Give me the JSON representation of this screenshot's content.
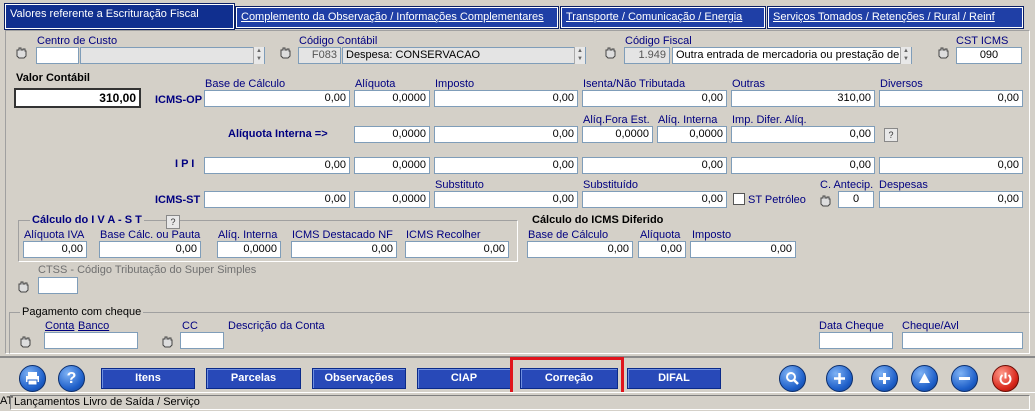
{
  "tabs": [
    "Valores referente a Escrituração Fiscal",
    "Complemento da Observação / Informações Complementares",
    "Transporte / Comunicação / Energia",
    "Serviços Tomados / Retenções / Rural / Reinf"
  ],
  "header": {
    "centro_custo_label": "Centro de Custo",
    "centro_custo_code": "",
    "centro_custo_desc": "",
    "codigo_contabil_label": "Código Contábil",
    "codigo_contabil_code": "F083",
    "codigo_contabil_desc": "Despesa: CONSERVACAO",
    "codigo_fiscal_label": "Código Fiscal",
    "codigo_fiscal_code": "1.949",
    "codigo_fiscal_desc": "Outra entrada de mercadoria ou prestação de",
    "cst_icms_label": "CST ICMS",
    "cst_icms_value": "090"
  },
  "valor_contabil": {
    "label": "Valor Contábil",
    "value": "310,00"
  },
  "icms_op": {
    "row_label": "ICMS-OP",
    "base_label": "Base de Cálculo",
    "base": "0,00",
    "aliquota_label": "Alíquota",
    "aliquota": "0,0000",
    "imposto_label": "Imposto",
    "imposto": "0,00",
    "isenta_label": "Isenta/Não Tributada",
    "isenta": "0,00",
    "outras_label": "Outras",
    "outras": "310,00",
    "diversos_label": "Diversos",
    "diversos": "0,00"
  },
  "aliquota_interna": {
    "row_label": "Alíquota Interna =>",
    "aliquota": "0,0000",
    "imposto": "0,00",
    "aliq_fora_label": "Alíq.Fora Est.",
    "aliq_fora": "0,0000",
    "aliq_interna_label": "Alíq. Interna",
    "aliq_interna": "0,0000",
    "imp_difer_label": "Imp. Difer. Alíq.",
    "imp_difer": "0,00",
    "help": "?"
  },
  "ipi": {
    "row_label": "I P I",
    "base": "0,00",
    "aliquota": "0,0000",
    "imposto": "0,00",
    "isenta": "0,00",
    "outras": "0,00",
    "diversos": "0,00"
  },
  "icms_st": {
    "row_label": "ICMS-ST",
    "base": "0,00",
    "aliquota": "0,0000",
    "imposto": "0,00",
    "substituto_label": "Substituto",
    "substituto": "0,00",
    "substituido_label": "Substituído",
    "substituido": "0,00",
    "st_petroleo_label": "ST Petróleo",
    "c_antecip_label": "C. Antecip.",
    "c_antecip": "0",
    "despesas_label": "Despesas",
    "despesas": "0,00"
  },
  "iva_st": {
    "title": "Cálculo do I V A - S T",
    "help": "?",
    "aliquota_iva_label": "Alíquota IVA",
    "aliquota_iva": "0,00",
    "base_pauta_label": "Base Cálc. ou Pauta",
    "base_pauta": "0,00",
    "aliq_interna_label": "Alíq. Interna",
    "aliq_interna": "0,0000",
    "icms_destacado_label": "ICMS Destacado NF",
    "icms_destacado": "0,00",
    "icms_recolher_label": "ICMS Recolher",
    "icms_recolher": "0,00"
  },
  "diferido": {
    "title": "Cálculo do ICMS Diferido",
    "base_label": "Base de Cálculo",
    "base": "0,00",
    "aliquota_label": "Alíquota",
    "aliquota": "0,00",
    "imposto_label": "Imposto",
    "imposto": "0,00"
  },
  "ctss": {
    "label": "CTSS - Código Tributação do Super Simples",
    "value": ""
  },
  "cheque": {
    "title": "Pagamento com cheque",
    "conta_label": "Conta",
    "banco_label": "Banco",
    "conta": "",
    "cc_label": "CC",
    "cc": "",
    "descricao_label": "Descrição da Conta",
    "data_label": "Data Cheque",
    "data": "",
    "cheque_avl_label": "Cheque/Avl",
    "cheque_avl": ""
  },
  "toolbar": {
    "itens": "Itens",
    "parcelas": "Parcelas",
    "observacoes": "Observações",
    "ciap": "CIAP",
    "correcao": "Correção",
    "difal": "DIFAL",
    "help": "?"
  },
  "status": {
    "prefix": "AT",
    "text": "Lançamentos Livro de Saída / Serviço"
  },
  "colors": {
    "tab_bg": "#1f3fa6",
    "button_bg": "#2849b8",
    "highlight": "#e0141c",
    "window_bg": "#d4d0c8"
  }
}
